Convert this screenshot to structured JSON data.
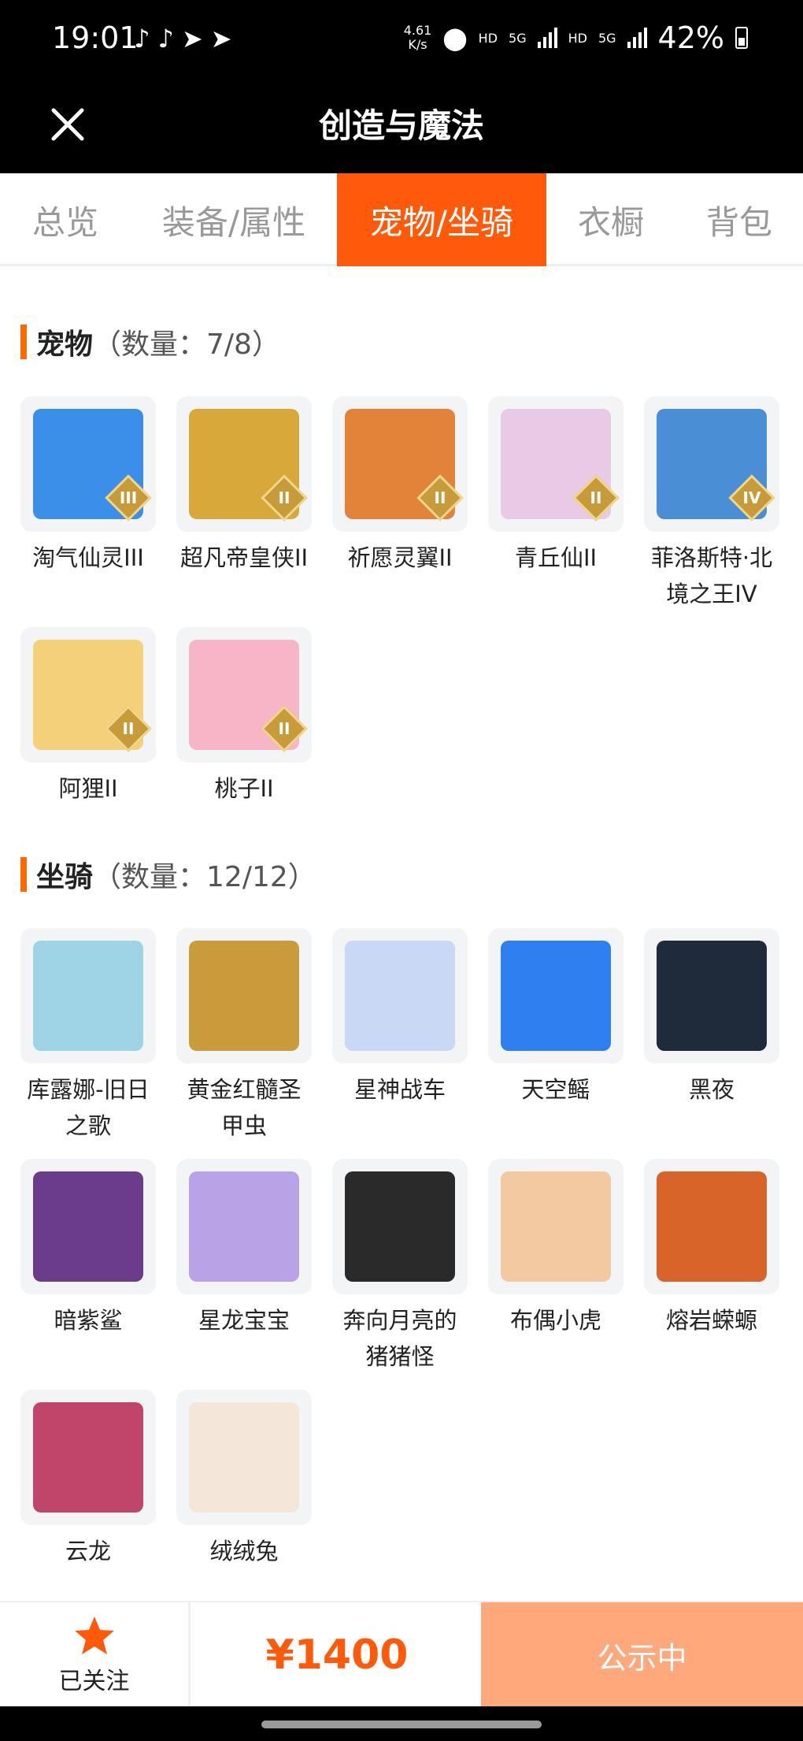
{
  "status_bar": {
    "time": "19:01",
    "speed": "4.61\nK/s",
    "net1": "HD",
    "net2": "5G",
    "net3": "HD",
    "net4": "5G",
    "battery": "42%",
    "icons": [
      "tiktok-icon",
      "tiktok-icon",
      "telegram-icon",
      "telegram-icon",
      "location-icon",
      "signal-icon",
      "battery-icon"
    ]
  },
  "header": {
    "title": "创造与魔法"
  },
  "tabs": [
    {
      "label": "总览",
      "active": false
    },
    {
      "label": "装备/属性",
      "active": false
    },
    {
      "label": "宠物/坐骑",
      "active": true
    },
    {
      "label": "衣橱",
      "active": false
    },
    {
      "label": "背包",
      "active": false
    }
  ],
  "pets": {
    "title": "宠物",
    "count": "（数量：7/8）",
    "items": [
      {
        "name": "淘气仙灵III",
        "rank": "III",
        "color": "#3c8fe8"
      },
      {
        "name": "超凡帝皇侠II",
        "rank": "II",
        "color": "#d8a93a"
      },
      {
        "name": "祈愿灵翼II",
        "rank": "II",
        "color": "#e3833a"
      },
      {
        "name": "青丘仙II",
        "rank": "II",
        "color": "#e8c9e6"
      },
      {
        "name": "菲洛斯特·北境之王IV",
        "rank": "IV",
        "color": "#4a8fd6"
      },
      {
        "name": "阿狸II",
        "rank": "II",
        "color": "#f4d07a"
      },
      {
        "name": "桃子II",
        "rank": "II",
        "color": "#f7b6c8"
      }
    ]
  },
  "mounts": {
    "title": "坐骑",
    "count": "（数量：12/12）",
    "items": [
      {
        "name": "库露娜-旧日之歌",
        "color": "#9fd4e6"
      },
      {
        "name": "黄金红髓圣甲虫",
        "color": "#c99b3a"
      },
      {
        "name": "星神战车",
        "color": "#c9d8f4"
      },
      {
        "name": "天空鳐",
        "color": "#2f7ff0"
      },
      {
        "name": "黑夜",
        "color": "#1f2a3a"
      },
      {
        "name": "暗紫鲨",
        "color": "#6a3c8a"
      },
      {
        "name": "星龙宝宝",
        "color": "#b9a3e6"
      },
      {
        "name": "奔向月亮的猪猪怪",
        "color": "#2a2a2a"
      },
      {
        "name": "布偶小虎",
        "color": "#f2c9a0"
      },
      {
        "name": "熔岩蝾螈",
        "color": "#d9642a"
      },
      {
        "name": "云龙",
        "color": "#c0456a"
      },
      {
        "name": "绒绒兔",
        "color": "#f4e6d8"
      }
    ]
  },
  "bottom": {
    "follow_label": "已关注",
    "price": "¥1400",
    "status_button": "公示中"
  },
  "colors": {
    "accent": "#ff5a0a",
    "status_button": "#ffa87c",
    "star": "#ff5a0a"
  }
}
